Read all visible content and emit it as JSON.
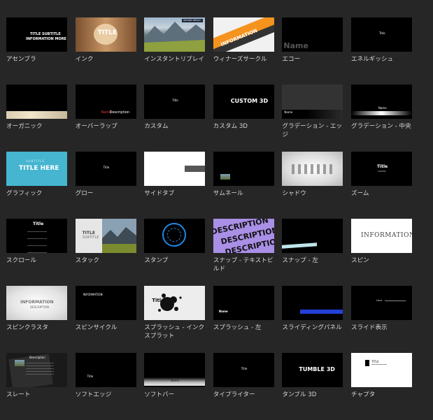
{
  "tiles": [
    {
      "key": "assembler",
      "label": "アセンブラ",
      "thumb_text": [
        "TITLE SUBTITLE",
        "INFORMATION MORE"
      ]
    },
    {
      "key": "ink",
      "label": "インク",
      "thumb_text": [
        "TITLE"
      ]
    },
    {
      "key": "instant-replay",
      "label": "インスタントリプレイ",
      "thumb_text": [
        "INSTANT REPLAY"
      ]
    },
    {
      "key": "winner-circle",
      "label": "ウィナーズサークル",
      "thumb_text": [
        "INFORMATION"
      ]
    },
    {
      "key": "echo",
      "label": "エコー",
      "thumb_text": [
        "Name"
      ]
    },
    {
      "key": "energetic",
      "label": "エネルギッシュ",
      "thumb_text": [
        "Title"
      ]
    },
    {
      "key": "organic",
      "label": "オーガニック",
      "thumb_text": []
    },
    {
      "key": "overlap",
      "label": "オーバーラップ",
      "thumb_text": [
        "Name",
        "Description"
      ]
    },
    {
      "key": "custom",
      "label": "カスタム",
      "thumb_text": [
        "Title"
      ]
    },
    {
      "key": "custom-3d",
      "label": "カスタム 3D",
      "thumb_text": [
        "CUSTOM 3D"
      ]
    },
    {
      "key": "gradient-edge",
      "label": "グラデーション - エッジ",
      "thumb_text": [
        "Name"
      ]
    },
    {
      "key": "gradient-center",
      "label": "グラデーション - 中央",
      "thumb_text": [
        "Name"
      ]
    },
    {
      "key": "graphic",
      "label": "グラフィック",
      "thumb_text": [
        "SUBTITLE",
        "TITLE HERE"
      ]
    },
    {
      "key": "glow",
      "label": "グロー",
      "thumb_text": [
        "Title"
      ]
    },
    {
      "key": "side-tab",
      "label": "サイドタブ",
      "thumb_text": []
    },
    {
      "key": "thumbnail",
      "label": "サムネール",
      "thumb_text": []
    },
    {
      "key": "shadow",
      "label": "シャドウ",
      "thumb_text": []
    },
    {
      "key": "zoom",
      "label": "ズーム",
      "thumb_text": [
        "Title",
        "Subtitle"
      ]
    },
    {
      "key": "scroll",
      "label": "スクロール",
      "thumb_text": [
        "Title"
      ]
    },
    {
      "key": "stack",
      "label": "スタック",
      "thumb_text": [
        "TITLE",
        "SUBTITLE"
      ]
    },
    {
      "key": "stamp",
      "label": "スタンプ",
      "thumb_text": []
    },
    {
      "key": "snap-text-build",
      "label": "スナップ - テキストビルド",
      "thumb_text": [
        "DESCRIPTION"
      ]
    },
    {
      "key": "snap-left",
      "label": "スナップ - 左",
      "thumb_text": []
    },
    {
      "key": "spin",
      "label": "スピン",
      "thumb_text": [
        "INFORMATION"
      ]
    },
    {
      "key": "spin-cluster",
      "label": "スピンクラスタ",
      "thumb_text": [
        "INFORMATION",
        "DESCRIPTION"
      ]
    },
    {
      "key": "spin-cycle",
      "label": "スピンサイクル",
      "thumb_text": [
        "INFORMATION"
      ]
    },
    {
      "key": "splash-ink",
      "label": "スプラッシュ - インクスプラット",
      "thumb_text": [
        "Title"
      ]
    },
    {
      "key": "splash-left",
      "label": "スプラッシュ - 左",
      "thumb_text": [
        "Name"
      ]
    },
    {
      "key": "sliding-panel",
      "label": "スライディングパネル",
      "thumb_text": []
    },
    {
      "key": "slide-show",
      "label": "スライド表示",
      "thumb_text": [
        "TITLE"
      ]
    },
    {
      "key": "slate",
      "label": "スレート",
      "thumb_text": [
        "Description"
      ]
    },
    {
      "key": "soft-edge",
      "label": "ソフトエッジ",
      "thumb_text": [
        "Title"
      ]
    },
    {
      "key": "soft-bar",
      "label": "ソフトバー",
      "thumb_text": [
        "Name"
      ]
    },
    {
      "key": "typewriter",
      "label": "タイプライター",
      "thumb_text": [
        "Title"
      ]
    },
    {
      "key": "tumble-3d",
      "label": "タンブル 3D",
      "thumb_text": [
        "TUMBLE 3D"
      ]
    },
    {
      "key": "chapter",
      "label": "チャプタ",
      "thumb_text": [
        "TITLE"
      ]
    }
  ],
  "colors": {
    "background": "#262626",
    "label": "#d8d8d8",
    "graphic_cyan": "#45b5d0",
    "snap_purple": "#a98fe6",
    "winner_orange": "#f4931e"
  }
}
